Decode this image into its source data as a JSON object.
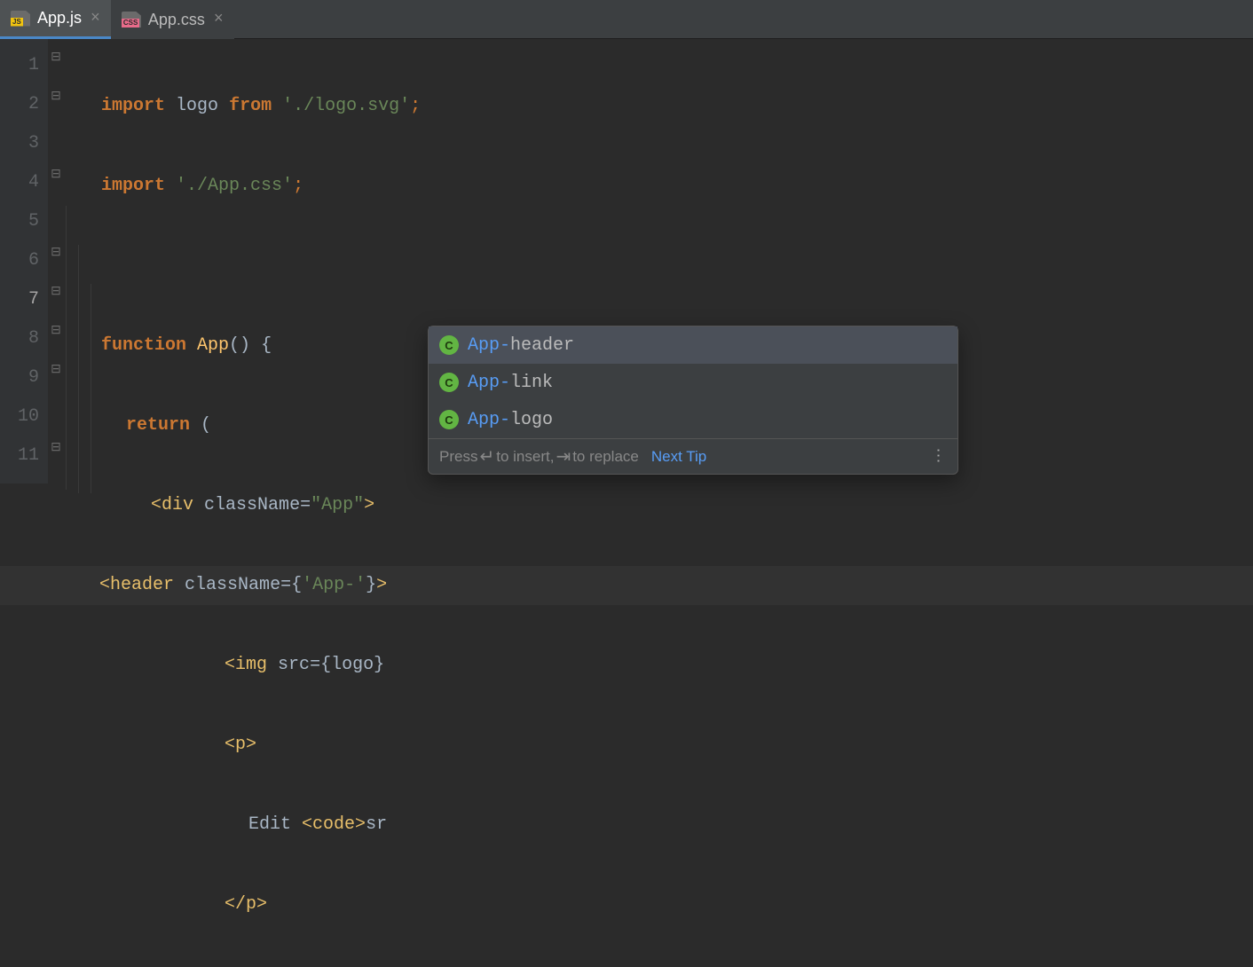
{
  "tabs": [
    {
      "label": "App.js",
      "icon": "JS",
      "active": true
    },
    {
      "label": "App.css",
      "icon": "CSS",
      "active": false
    }
  ],
  "gutter": {
    "lines": [
      "1",
      "2",
      "3",
      "4",
      "5",
      "6",
      "7",
      "8",
      "9",
      "10",
      "11"
    ],
    "current": 7
  },
  "code": {
    "l1": {
      "kw": "import",
      "id": "logo",
      "from": "from",
      "str": "'./logo.svg'",
      "semi": ";"
    },
    "l2": {
      "kw": "import",
      "str": "'./App.css'",
      "semi": ";"
    },
    "l4": {
      "kw": "function",
      "name": "App",
      "parens": "()",
      "brace": "{"
    },
    "l5": {
      "kw": "return",
      "paren": "("
    },
    "l6": {
      "open": "<",
      "tag": "div",
      "attr": "className",
      "eq": "=",
      "str": "\"App\"",
      "close": ">"
    },
    "l7": {
      "open": "<",
      "tag": "header",
      "attr": "className",
      "eq": "=",
      "openb": "{",
      "str": "'App-'",
      "closeb": "}",
      "close": ">"
    },
    "l8": {
      "open": "<",
      "tag": "img",
      "attr": "src",
      "eq": "=",
      "openb": "{",
      "id": "logo",
      "closeb": "}"
    },
    "l9": {
      "open": "<",
      "tag": "p",
      "close": ">"
    },
    "l10": {
      "text": "Edit ",
      "open": "<",
      "tag": "code",
      "close": ">",
      "tail": "sr"
    },
    "l11": {
      "open": "</",
      "tag": "p",
      "close": ">"
    }
  },
  "popup": {
    "items": [
      {
        "prefix": "App-",
        "suffix": "header",
        "selected": true
      },
      {
        "prefix": "App-",
        "suffix": "link",
        "selected": false
      },
      {
        "prefix": "App-",
        "suffix": "logo",
        "selected": false
      }
    ],
    "footer": {
      "press": "Press ",
      "enter_glyph": "↵",
      "insert": " to insert, ",
      "tab_glyph": "⇥",
      "replace": " to replace",
      "link": "Next Tip"
    }
  }
}
